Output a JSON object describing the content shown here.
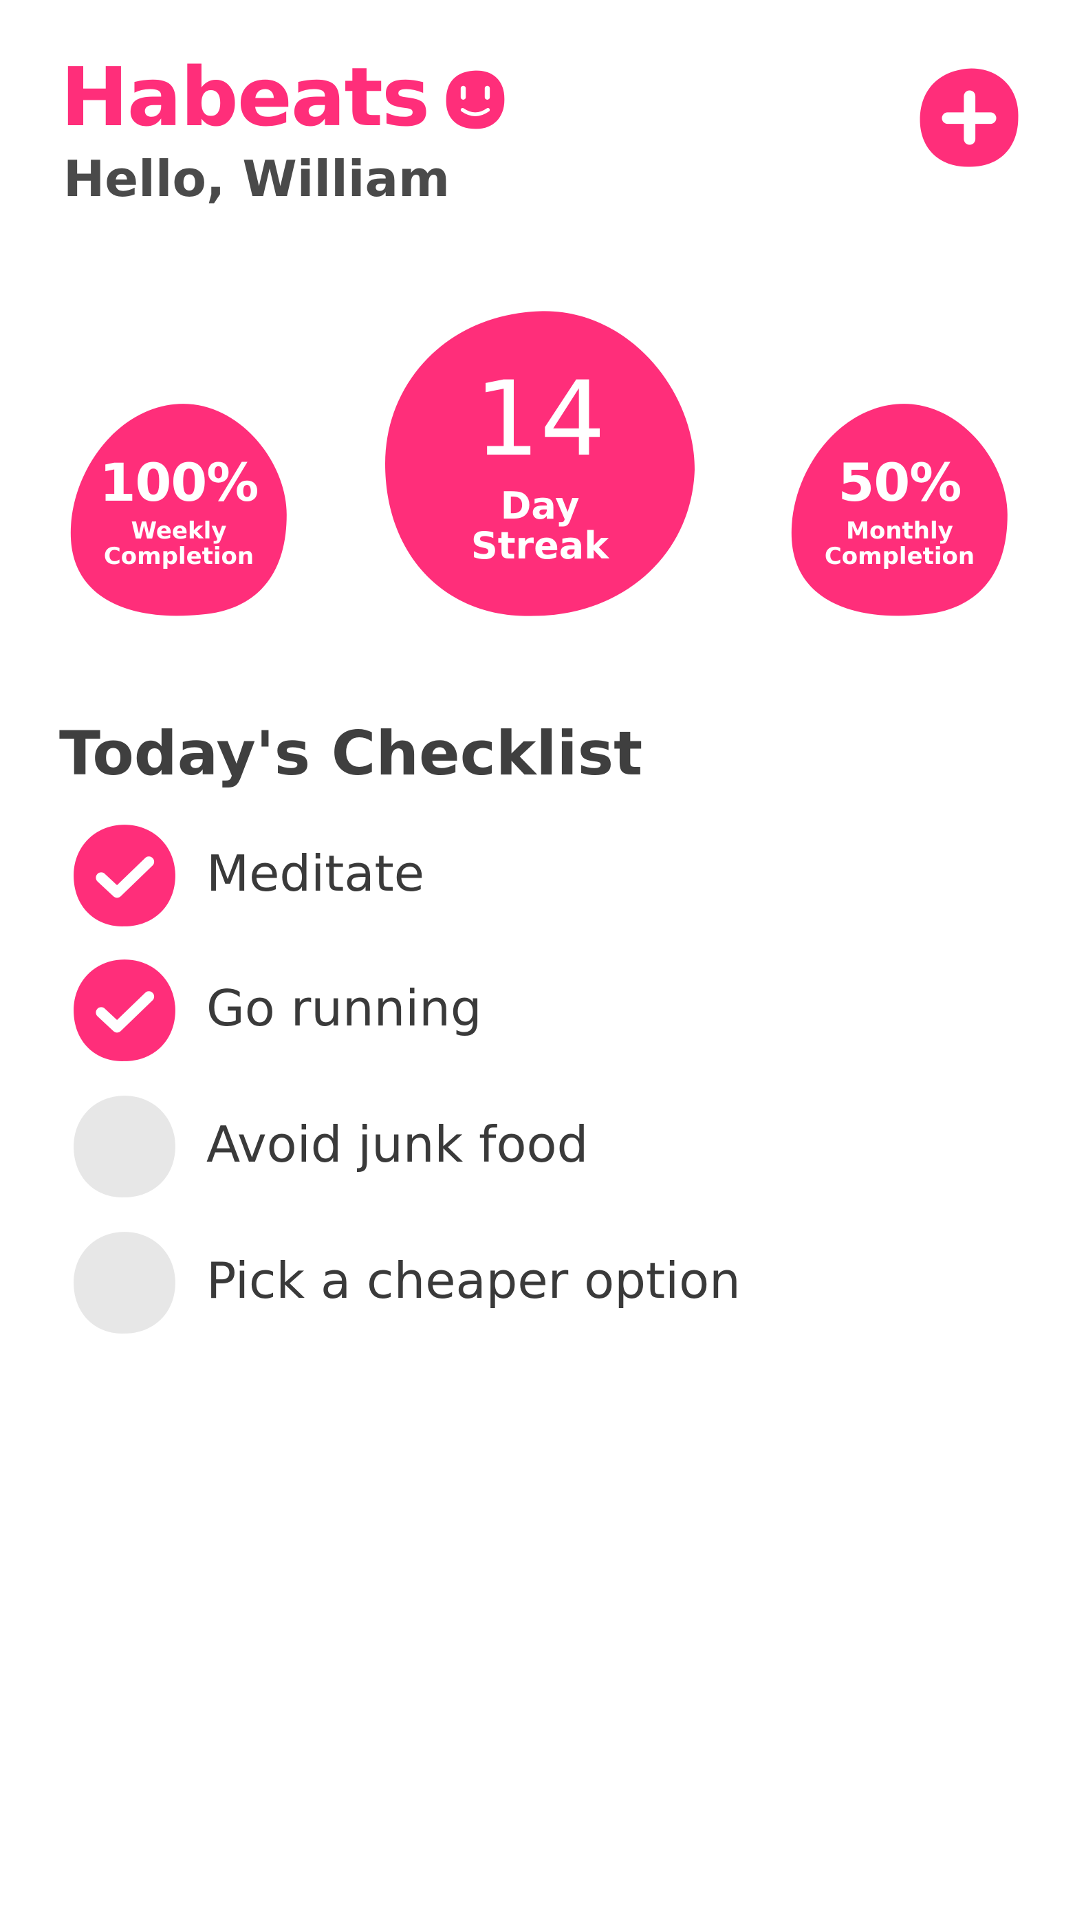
{
  "app": {
    "title": "Habeats",
    "logo_icon": "smile-icon",
    "greeting": "Hello, William",
    "add_button_icon": "plus-icon"
  },
  "colors": {
    "accent": "#ff2e7a",
    "unchecked": "#e7e7e7",
    "text": "#3a3a3a"
  },
  "stats": {
    "weekly": {
      "value": "100%",
      "label_line1": "Weekly",
      "label_line2": "Completion"
    },
    "streak": {
      "value": "14",
      "label_line1": "Day",
      "label_line2": "Streak"
    },
    "monthly": {
      "value": "50%",
      "label_line1": "Monthly",
      "label_line2": "Completion"
    }
  },
  "checklist": {
    "title": "Today's Checklist",
    "items": [
      {
        "label": "Meditate",
        "checked": true
      },
      {
        "label": "Go running",
        "checked": true
      },
      {
        "label": "Avoid junk food",
        "checked": false
      },
      {
        "label": "Pick a cheaper option",
        "checked": false
      }
    ]
  }
}
